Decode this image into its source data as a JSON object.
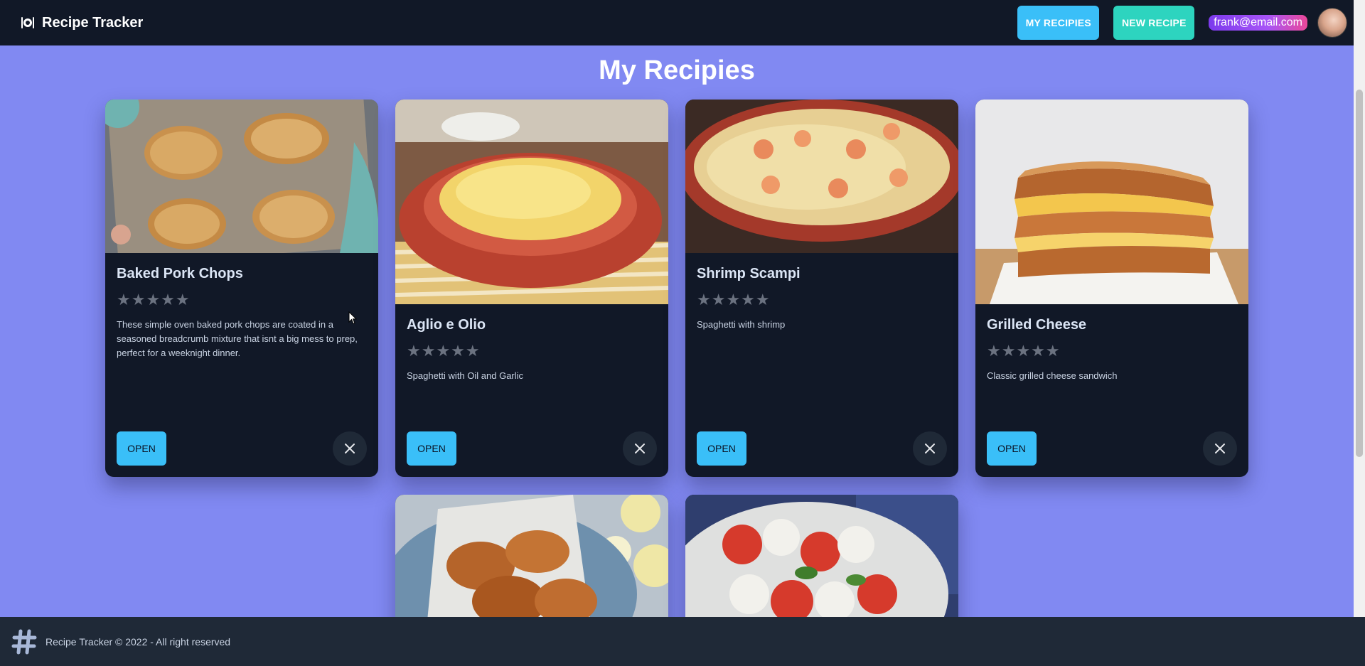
{
  "app": {
    "title": "Recipe Tracker"
  },
  "nav": {
    "my_recipes_label": "MY RECIPIES",
    "new_recipe_label": "NEW RECIPE",
    "user_email": "frank@email.com"
  },
  "page": {
    "title": "My Recipies"
  },
  "recipes": [
    {
      "title": "Baked Pork Chops",
      "rating_stars": "★★★★★",
      "rating": 0,
      "description": "These simple oven baked pork chops are coated in a seasoned breadcrumb mixture that isnt a big mess to prep, perfect for a weeknight dinner.",
      "open_label": "OPEN",
      "image": "baked-pork-chops-photo"
    },
    {
      "title": "Aglio e Olio",
      "rating_stars": "★★★★★",
      "rating": 0,
      "description": "Spaghetti with Oil and Garlic",
      "open_label": "OPEN",
      "image": "aglio-e-olio-photo"
    },
    {
      "title": "Shrimp Scampi",
      "rating_stars": "★★★★★",
      "rating": 0,
      "description": "Spaghetti with shrimp",
      "open_label": "OPEN",
      "image": "shrimp-scampi-photo"
    },
    {
      "title": "Grilled Cheese",
      "rating_stars": "★★★★★",
      "rating": 0,
      "description": "Classic grilled cheese sandwich",
      "open_label": "OPEN",
      "image": "grilled-cheese-photo"
    },
    {
      "image": "fried-chicken-photo"
    },
    {
      "image": "caprese-salad-photo"
    }
  ],
  "footer": {
    "text": "Recipe Tracker © 2022 - All right reserved"
  },
  "colors": {
    "background": "#8189f2",
    "navbar": "#111827",
    "card": "#111827",
    "accent_blue": "#3abff8",
    "accent_teal": "#2dd4bf",
    "footer": "#1f2937"
  }
}
